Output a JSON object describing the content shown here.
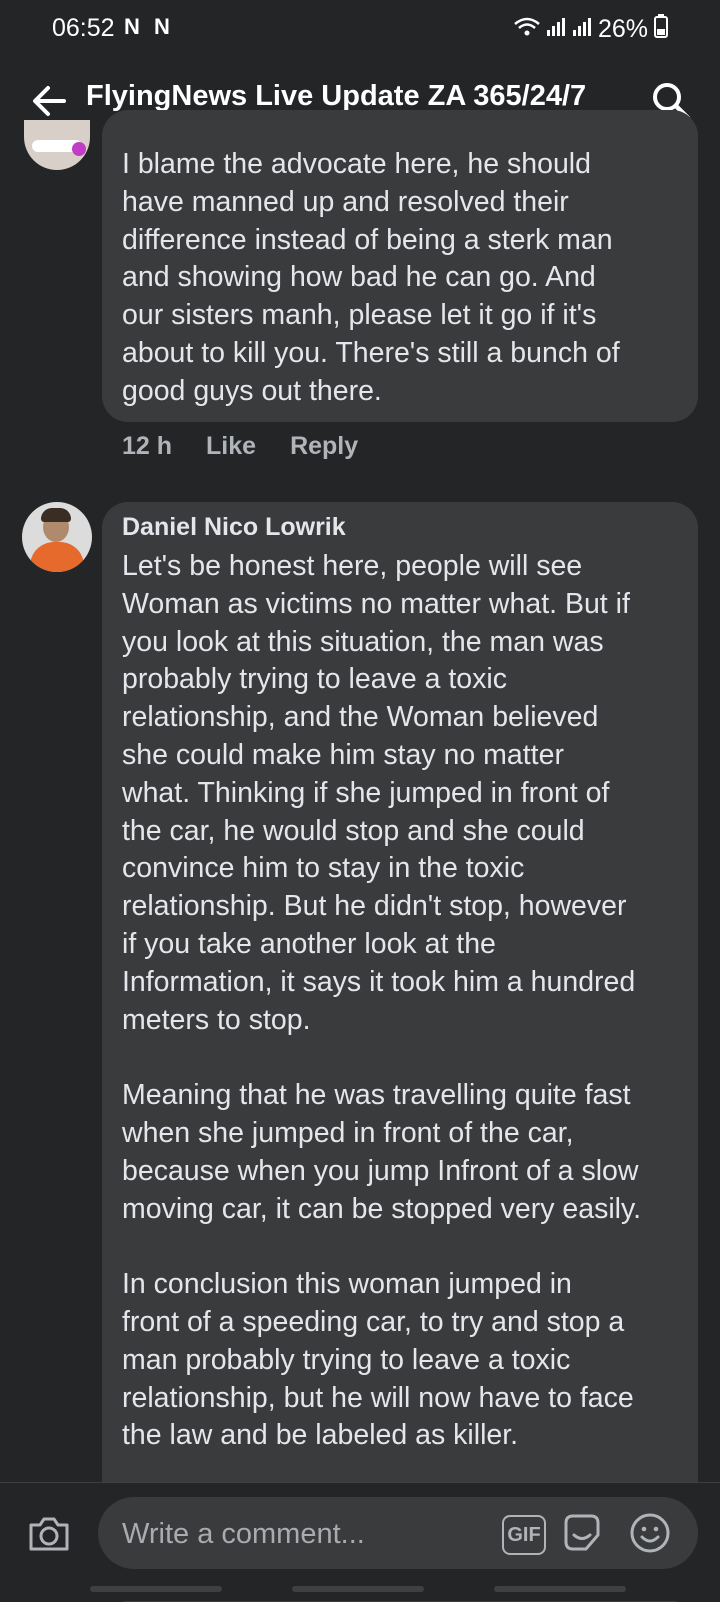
{
  "status_bar": {
    "time": "06:52",
    "notifications": "N N",
    "battery": "26%"
  },
  "header": {
    "title": "FlyingNews Live Update ZA 365/24/7"
  },
  "comment_1": {
    "lines": [
      "I blame the advocate here, he should",
      "have manned up and resolved their",
      "difference instead of being a sterk man",
      "and showing how bad he can go. And",
      "our sisters manh, please let it go if it's",
      "about to kill you. There's still a bunch of",
      "good guys out there."
    ],
    "time": "12 h",
    "like_label": "Like",
    "reply_label": "Reply"
  },
  "comment_2": {
    "author": "Daniel Nico Lowrik",
    "lines": [
      "Let's be honest here, people will see",
      "Woman as victims no matter what. But if",
      "you look at this situation, the man was",
      "probably trying to leave a toxic",
      "relationship, and the Woman believed",
      "she could make him stay no matter",
      "what. Thinking if she jumped in front of",
      "the car, he would stop and she could",
      "convince him to stay in the toxic",
      "relationship. But he didn't stop, however",
      "if you take another look at the",
      "Information, it says it took him a hundred",
      "meters to stop.",
      "",
      "Meaning that he was travelling quite fast",
      "when she jumped in front of the car,",
      "because when you jump Infront of a slow",
      "moving car, it can be stopped very easily.",
      "",
      "In conclusion this woman jumped in",
      "front of a speeding car, to try and stop a",
      "man probably trying to leave a toxic",
      "relationship, but he will now have to face",
      "the law and be labeled as killer."
    ]
  },
  "composer": {
    "placeholder": "Write a comment...",
    "gif_label": "GIF"
  },
  "icons": {
    "back": "arrow-left-icon",
    "search": "search-icon",
    "camera": "camera-icon",
    "sticker": "sticker-icon",
    "emoji": "emoji-icon"
  },
  "colors": {
    "background": "#242526",
    "bubble": "#3a3b3c",
    "text": "#e4e6eb",
    "muted": "#b0b3b8"
  }
}
